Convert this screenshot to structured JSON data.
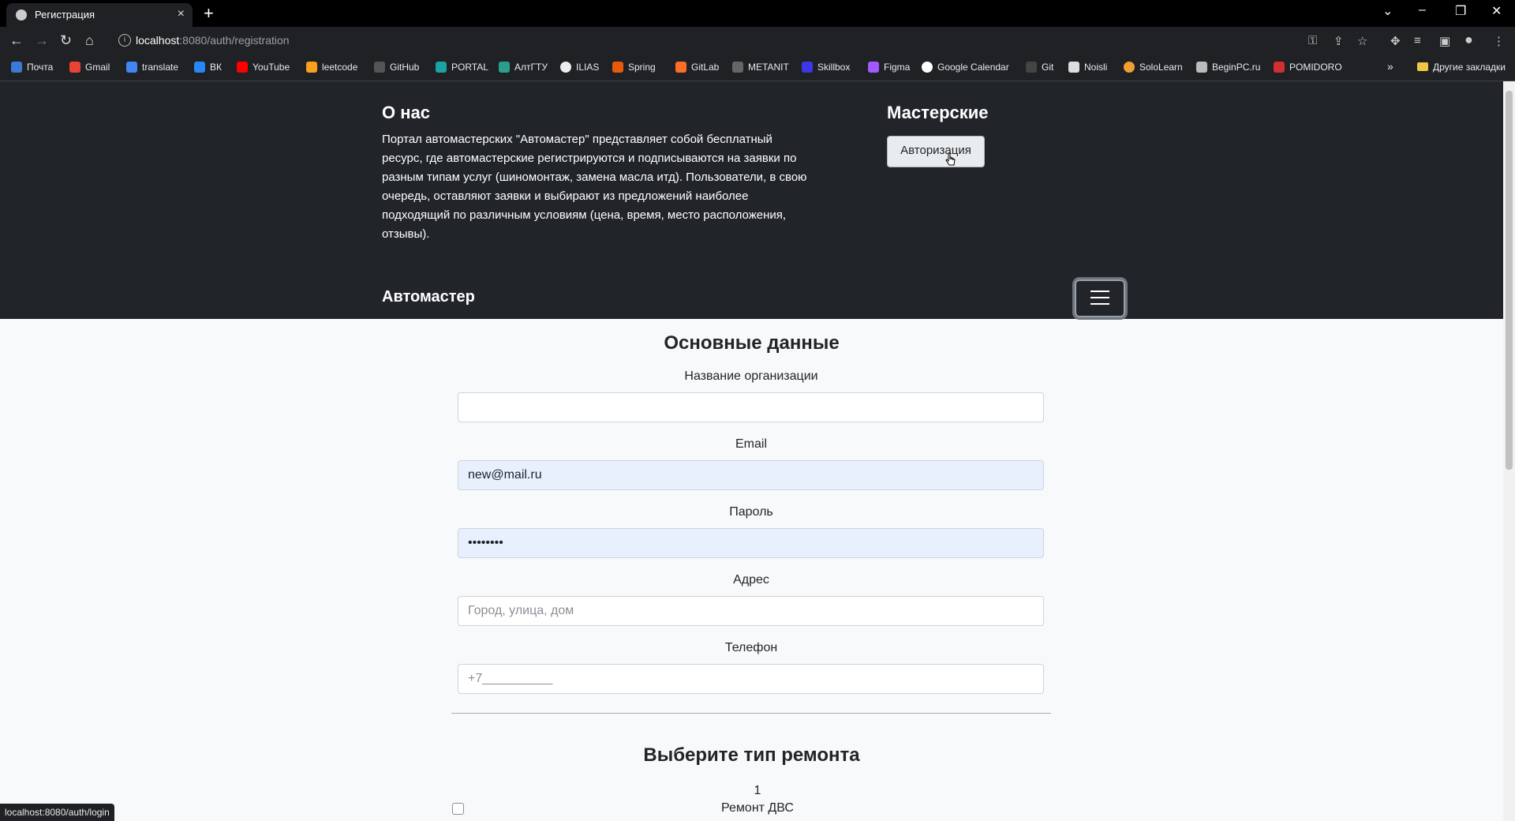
{
  "browser": {
    "tab_title": "Регистрация",
    "url_host": "localhost",
    "url_rest": ":8080/auth/registration",
    "bookmarks": [
      "Почта",
      "Gmail",
      "translate",
      "ВК",
      "YouTube",
      "leetcode",
      "GitHub",
      "PORTAL",
      "АлтГТУ",
      "ILIAS",
      "Spring",
      "GitLab",
      "METANIT",
      "Skillbox",
      "Figma",
      "Google Calendar",
      "Git",
      "Noisli",
      "SoloLearn",
      "BeginPC.ru",
      "POMIDORO"
    ],
    "other_bookmarks": "Другие закладки",
    "status_url": "localhost:8080/auth/login"
  },
  "header": {
    "about_title": "О нас",
    "about_text": "Портал автомастерских \"Автомастер\" представляет собой бесплатный ресурс, где автомастерские регистрируются и подписываются на заявки по разным типам услуг (шиномонтаж, замена масла итд). Пользователи, в свою очередь, оставляют заявки и выбирают из предложений наиболее подходящий по различным условиям (цена, время, место расположения, отзывы).",
    "workshops_title": "Мастерские",
    "auth_button": "Авторизация",
    "brand": "Автомастер"
  },
  "form": {
    "heading": "Основные данные",
    "org_label": "Название организации",
    "org_value": "",
    "email_label": "Email",
    "email_value": "new@mail.ru",
    "password_label": "Пароль",
    "password_value": "password",
    "address_label": "Адрес",
    "address_placeholder": "Город, улица, дом",
    "phone_label": "Телефон",
    "phone_placeholder": "+7__________"
  },
  "repair": {
    "heading": "Выберите тип ремонта",
    "first_item_number": "1",
    "first_item_name": "Ремонт ДВС"
  }
}
